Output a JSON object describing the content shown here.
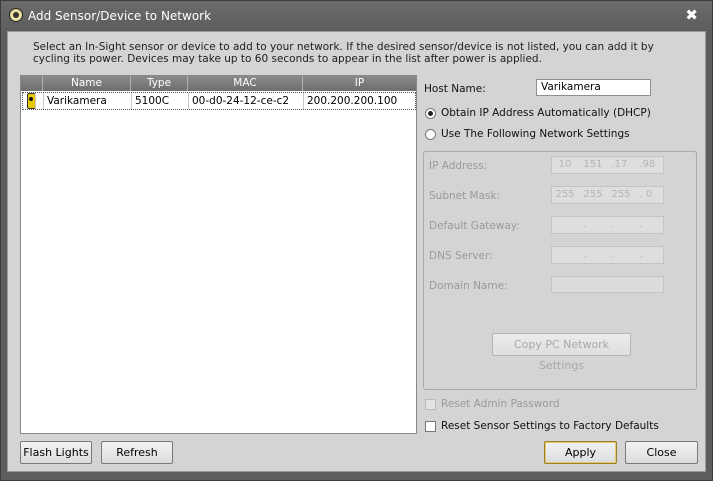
{
  "window": {
    "title": "Add Sensor/Device to Network",
    "close_glyph": "✖"
  },
  "instructions": "Select an In-Sight sensor or device to add to your network.  If the desired sensor/device is not listed, you can add it by cycling its power.  Devices may take up to 60 seconds to appear in the list after power is applied.",
  "device_list": {
    "columns": [
      "Name",
      "Type",
      "MAC",
      "IP"
    ],
    "rows": [
      {
        "icon": "camera-sensor-icon",
        "name": "Varikamera",
        "type": "5100C",
        "mac": "00-d0-24-12-ce-c2",
        "ip": "200.200.200.100"
      }
    ]
  },
  "host_name": {
    "label": "Host Name:",
    "value": "Varikamera"
  },
  "dhcp_option": {
    "label": "Obtain IP Address Automatically (DHCP)",
    "selected": true
  },
  "static_option": {
    "label": "Use The Following Network Settings",
    "selected": false
  },
  "network": {
    "ip_label": "IP Address:",
    "ip": [
      "10",
      "151",
      "17",
      "98"
    ],
    "subnet_label": "Subnet Mask:",
    "subnet": [
      "255",
      "255",
      "255",
      "0"
    ],
    "gateway_label": "Default Gateway:",
    "gateway": [
      "",
      "",
      "",
      ""
    ],
    "dns_label": "DNS Server:",
    "dns": [
      "",
      "",
      "",
      ""
    ],
    "domain_label": "Domain Name:",
    "domain": ""
  },
  "copy_pc_button": "Copy PC Network Settings",
  "reset_admin": {
    "label": "Reset Admin Password",
    "checked": false,
    "enabled": false
  },
  "reset_factory": {
    "label": "Reset Sensor Settings to Factory Defaults",
    "checked": false
  },
  "buttons": {
    "flash": "Flash Lights",
    "refresh": "Refresh",
    "apply": "Apply",
    "close": "Close"
  },
  "colors": {
    "titlebar": "#5d5d5d",
    "client": "#d4d4d4",
    "camera_icon": "#e6c800"
  }
}
